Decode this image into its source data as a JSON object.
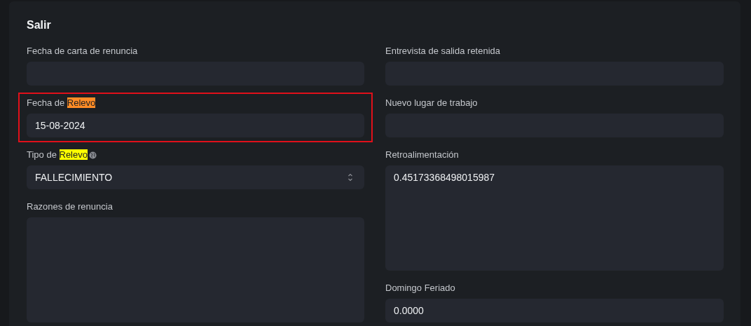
{
  "section": {
    "title": "Salir"
  },
  "columns": [
    {
      "fields": [
        {
          "kind": "input",
          "label": [
            {
              "text": "Fecha de carta de renuncia"
            }
          ]
        },
        {
          "kind": "input",
          "label": [
            {
              "text": "Fecha de "
            },
            {
              "text": "Relevo",
              "color": "#ff8c26"
            }
          ],
          "value": "15-08-2024",
          "outlined": true
        },
        {
          "kind": "select",
          "label": [
            {
              "text": "Tipo de "
            },
            {
              "text": "Relevo",
              "color": "#ffff00"
            }
          ],
          "info_icon": true,
          "value": "FALLECIMIENTO"
        },
        {
          "kind": "textarea",
          "label": [
            {
              "text": "Razones de renuncia"
            }
          ]
        }
      ]
    },
    {
      "fields": [
        {
          "kind": "input",
          "label": [
            {
              "text": "Entrevista de salida retenida"
            }
          ]
        },
        {
          "kind": "input",
          "label": [
            {
              "text": "Nuevo lugar de trabajo"
            }
          ]
        },
        {
          "kind": "textarea",
          "label": [
            {
              "text": "Retroalimentación"
            }
          ],
          "value": "0.45173368498015987"
        },
        {
          "kind": "input",
          "label": [
            {
              "text": "Domingo Feriado"
            }
          ],
          "value": "0.0000"
        }
      ]
    }
  ]
}
